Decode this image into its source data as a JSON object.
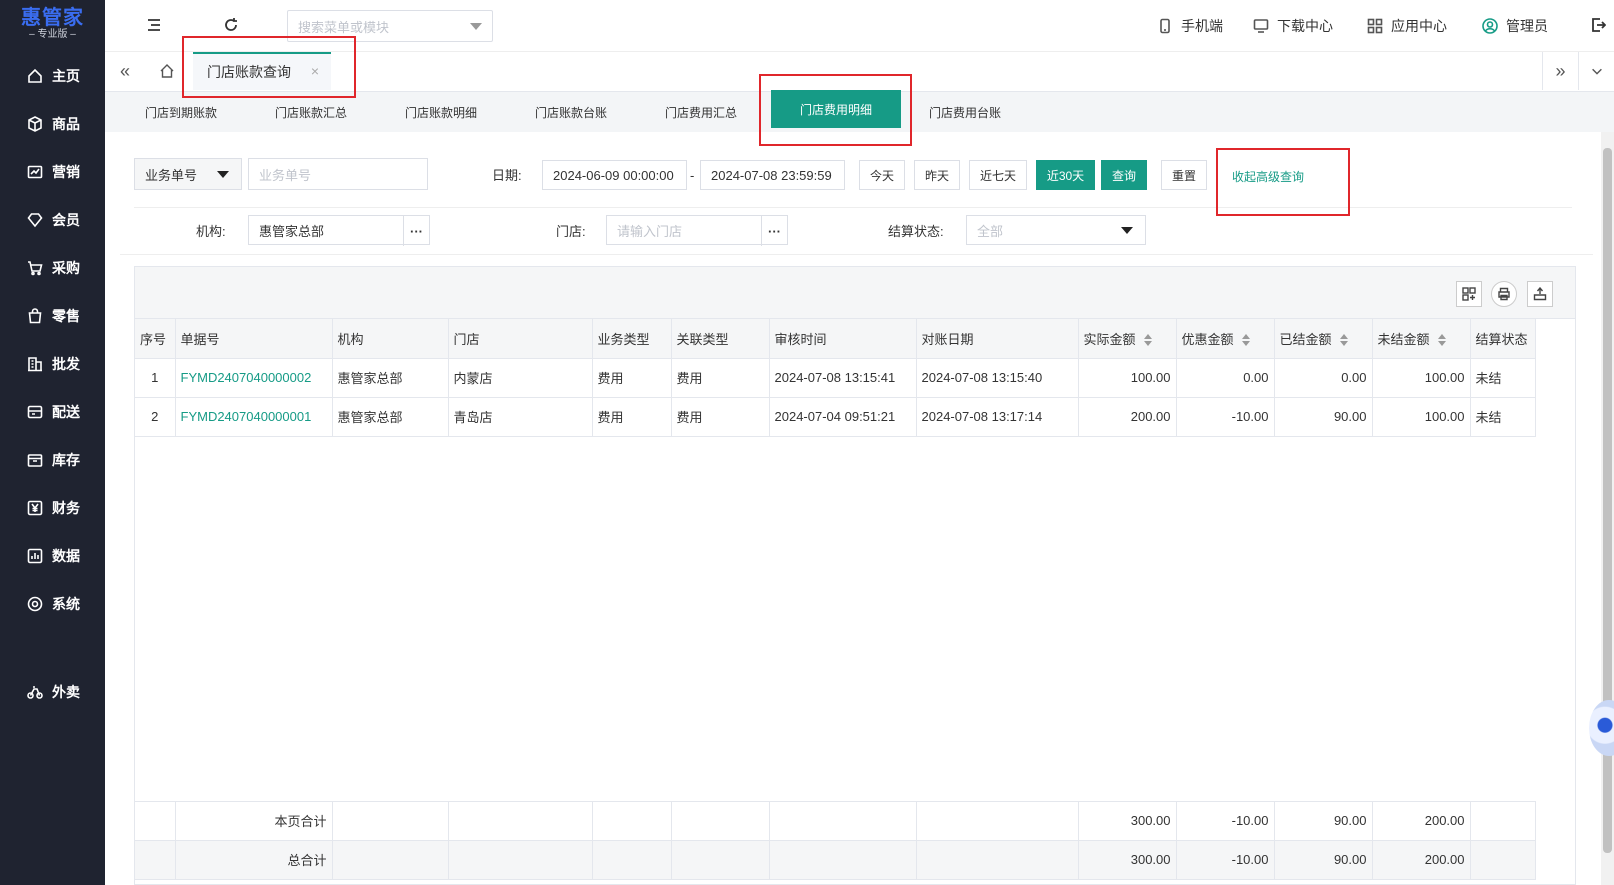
{
  "app": {
    "logo_main": "惠管家",
    "logo_sub": "– 专业版 –"
  },
  "sidebar": {
    "items": [
      {
        "label": "主页",
        "icon": "home-icon"
      },
      {
        "label": "商品",
        "icon": "cube-icon"
      },
      {
        "label": "营销",
        "icon": "chart-icon"
      },
      {
        "label": "会员",
        "icon": "diamond-icon"
      },
      {
        "label": "采购",
        "icon": "cart-icon"
      },
      {
        "label": "零售",
        "icon": "bag-icon"
      },
      {
        "label": "批发",
        "icon": "building-icon"
      },
      {
        "label": "配送",
        "icon": "delivery-icon"
      },
      {
        "label": "库存",
        "icon": "box-icon"
      },
      {
        "label": "财务",
        "icon": "yen-icon"
      },
      {
        "label": "数据",
        "icon": "data-icon"
      },
      {
        "label": "系统",
        "icon": "gear-icon"
      },
      {
        "label": "外卖",
        "icon": "bike-icon"
      }
    ]
  },
  "topbar": {
    "search_placeholder": "搜索菜单或模块",
    "mobile": "手机端",
    "download": "下载中心",
    "apps": "应用中心",
    "user": "管理员"
  },
  "tabstrip": {
    "active_tab": "门店账款查询",
    "close": "×"
  },
  "subtabs": [
    "门店到期账款",
    "门店账款汇总",
    "门店账款明细",
    "门店账款台账",
    "门店费用汇总",
    "门店费用明细",
    "门店费用台账"
  ],
  "filters": {
    "doc_type": "业务单号",
    "doc_placeholder": "业务单号",
    "date_label": "日期:",
    "date_from": "2024-06-09 00:00:00",
    "date_sep": "-",
    "date_to": "2024-07-08 23:59:59",
    "btn_today": "今天",
    "btn_yesterday": "昨天",
    "btn_7days": "近七天",
    "btn_30days": "近30天",
    "btn_query": "查询",
    "btn_reset": "重置",
    "collapse_link": "收起高级查询",
    "org_label": "机构:",
    "org_value": "惠管家总部",
    "store_label": "门店:",
    "store_placeholder": "请输入门店",
    "status_label": "结算状态:",
    "status_value": "全部",
    "more": "···"
  },
  "table": {
    "columns": [
      "序号",
      "单据号",
      "机构",
      "门店",
      "业务类型",
      "关联类型",
      "审核时间",
      "对账日期",
      "实际金额",
      "优惠金额",
      "已结金额",
      "未结金额",
      "结算状态"
    ],
    "rows": [
      [
        "1",
        "FYMD2407040000002",
        "惠管家总部",
        "内蒙店",
        "费用",
        "费用",
        "2024-07-08 13:15:41",
        "2024-07-08 13:15:40",
        "100.00",
        "0.00",
        "0.00",
        "100.00",
        "未结"
      ],
      [
        "2",
        "FYMD2407040000001",
        "惠管家总部",
        "青岛店",
        "费用",
        "费用",
        "2024-07-04 09:51:21",
        "2024-07-08 13:17:14",
        "200.00",
        "-10.00",
        "90.00",
        "100.00",
        "未结"
      ]
    ],
    "page_total": {
      "label": "本页合计",
      "actual": "300.00",
      "discount": "-10.00",
      "settled": "90.00",
      "unsettled": "200.00"
    },
    "grand_total": {
      "label": "总合计",
      "actual": "300.00",
      "discount": "-10.00",
      "settled": "90.00",
      "unsettled": "200.00"
    }
  },
  "colors": {
    "accent": "#169b86",
    "sidebar": "#1f2330",
    "highlight": "#e0262b"
  }
}
